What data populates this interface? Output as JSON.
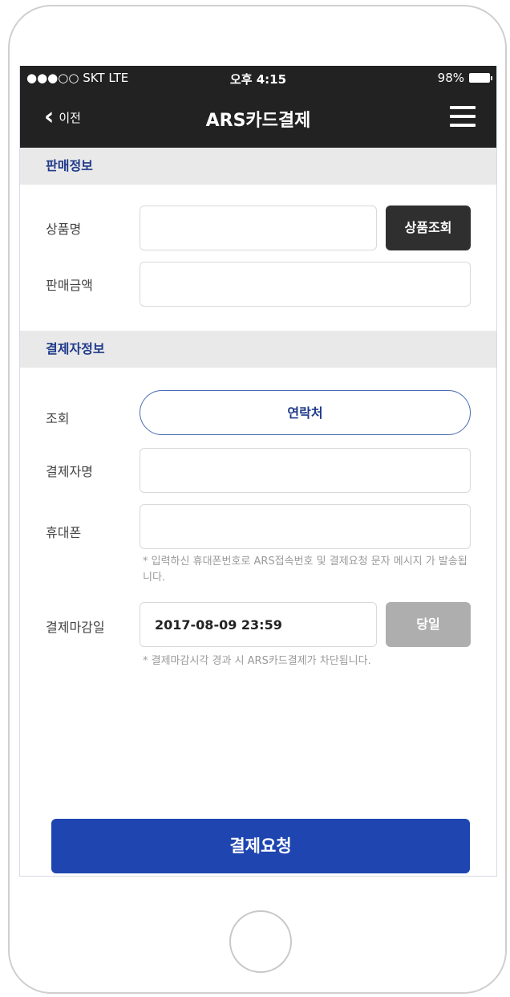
{
  "status_bar": {
    "carrier": "●●●○○ SKT  LTE",
    "time": "오후 4:15",
    "battery": "98%"
  },
  "nav": {
    "back_label": "이전",
    "title": "ARS카드결제",
    "back_icon": "chevron-left-icon",
    "menu_icon": "hamburger-menu-icon"
  },
  "sales_section": {
    "header": "판매정보",
    "product_label": "상품명",
    "product_value": "",
    "product_search_button": "상품조회",
    "amount_label": "판매금액",
    "amount_value": ""
  },
  "payer_section": {
    "header": "결제자정보",
    "lookup_label": "조회",
    "contact_button": "연락처",
    "payer_name_label": "결제자명",
    "payer_name_value": "",
    "phone_label": "휴대폰",
    "phone_value": "",
    "phone_note": "* 입력하신 휴대폰번호로 ARS접속번호 및 결제요청 문자 메시지 가 발송됩니다.",
    "deadline_label": "결제마감일",
    "deadline_value": "2017-08-09 23:59",
    "today_button": "당일",
    "deadline_note": "* 결제마감시각 경과 시 ARS카드결제가 차단됩니다."
  },
  "footer": {
    "pay_button": "결제요청"
  },
  "colors": {
    "nav_bg": "#222222",
    "section_bg": "#e9e9e9",
    "section_text": "#1f3a8a",
    "primary_button": "#1e45b0",
    "dark_button": "#2f2f2f",
    "disabled_button": "#aeaeae"
  }
}
